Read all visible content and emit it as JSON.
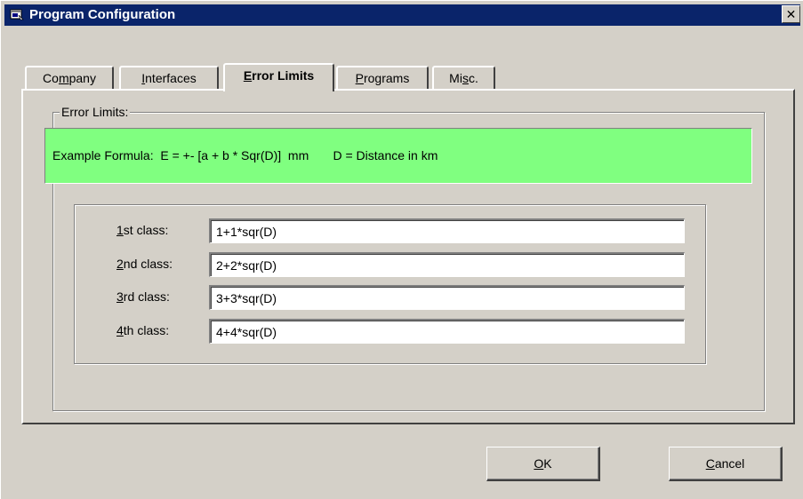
{
  "window": {
    "title": "Program Configuration",
    "close_label": "✕"
  },
  "tabs": [
    {
      "pre": "Co",
      "u": "m",
      "post": "pany",
      "active": false
    },
    {
      "pre": "",
      "u": "I",
      "post": "nterfaces",
      "active": false
    },
    {
      "pre": "",
      "u": "E",
      "post": "rror Limits",
      "active": true
    },
    {
      "pre": "",
      "u": "P",
      "post": "rograms",
      "active": false
    },
    {
      "pre": "Mi",
      "u": "s",
      "post": "c.",
      "active": false
    }
  ],
  "group": {
    "caption": "Error Limits:"
  },
  "formula": {
    "text": "Example Formula:  E = +- [a + b * Sqr(D)]  mm       D = Distance in km",
    "background": "#80ff80"
  },
  "classes": [
    {
      "u": "1",
      "label_rest": "st class:",
      "value": "1+1*sqr(D)"
    },
    {
      "u": "2",
      "label_rest": "nd class:",
      "value": "2+2*sqr(D)"
    },
    {
      "u": "3",
      "label_rest": "rd class:",
      "value": "3+3*sqr(D)"
    },
    {
      "u": "4",
      "label_rest": "th class:",
      "value": "4+4*sqr(D)"
    }
  ],
  "buttons": {
    "ok": {
      "u": "O",
      "post": "K"
    },
    "cancel": {
      "u": "C",
      "post": "ancel"
    }
  },
  "colors": {
    "titlebar": "#0a246a",
    "face": "#d4d0c8"
  }
}
